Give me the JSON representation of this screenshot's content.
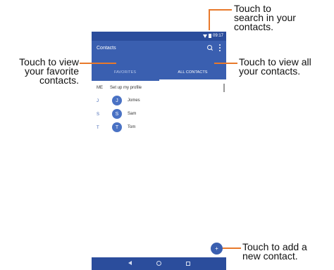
{
  "status": {
    "time": "09:17"
  },
  "appbar": {
    "title": "Contacts",
    "search_icon": "search-icon",
    "more_icon": "more-vert-icon"
  },
  "tabs": [
    {
      "label": "FAVORITES",
      "active": false
    },
    {
      "label": "ALL CONTACTS",
      "active": true
    }
  ],
  "profile": {
    "tag": "ME",
    "text": "Set up my profile"
  },
  "contacts": [
    {
      "letter": "J",
      "initial": "J",
      "name": "Jomes"
    },
    {
      "letter": "S",
      "initial": "S",
      "name": "Sam"
    },
    {
      "letter": "T",
      "initial": "T",
      "name": "Tom"
    }
  ],
  "fab": {
    "glyph": "+",
    "icon": "add-contact-icon"
  },
  "navbar": {
    "back_icon": "back-icon",
    "home_icon": "home-icon",
    "recent_icon": "recents-icon"
  },
  "callouts": {
    "search": [
      "Touch to",
      "search in your",
      "contacts."
    ],
    "favorites": [
      "Touch to view",
      "your favorite",
      "contacts."
    ],
    "all": [
      "Touch to view all",
      "your contacts."
    ],
    "add": [
      "Touch to add a",
      "new contact."
    ]
  },
  "colors": {
    "primary": "#3a5fb0",
    "primary_dark": "#2b4d9c",
    "avatar": "#4a72c4",
    "callout_line": "#e8792b"
  }
}
